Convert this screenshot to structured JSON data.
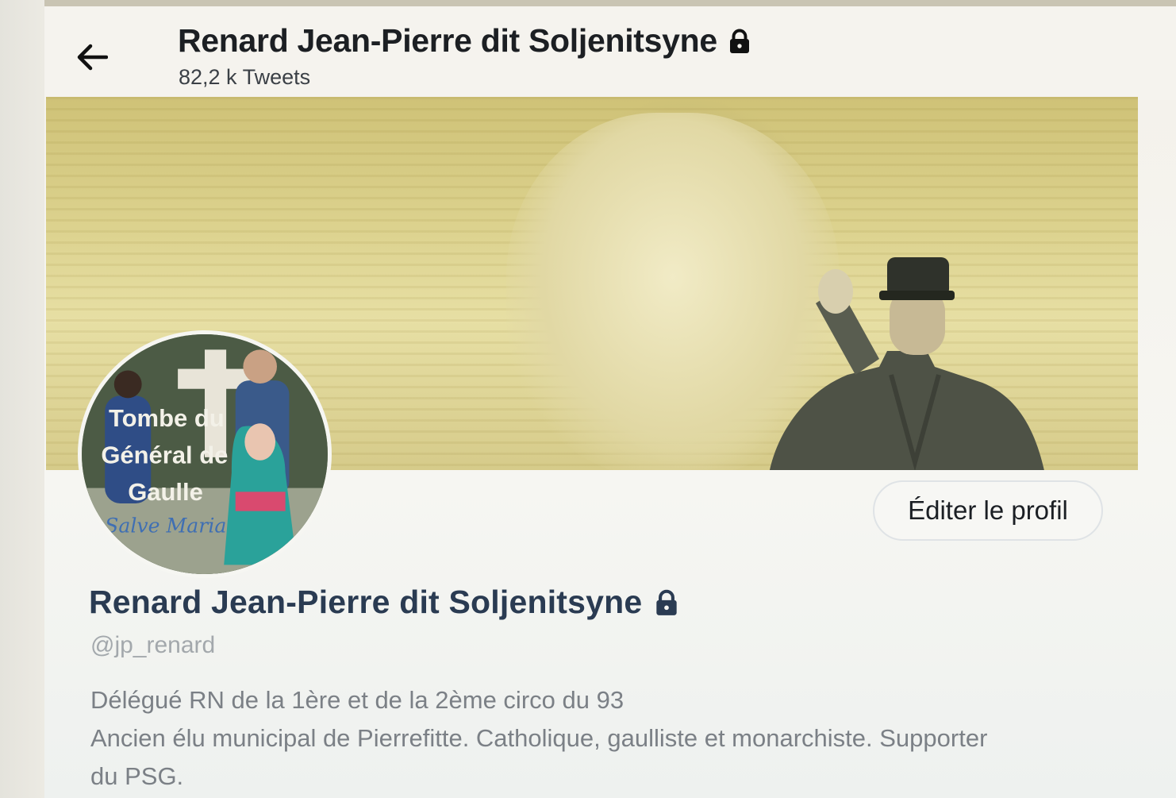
{
  "header": {
    "back_icon": "arrow-left-icon",
    "title": "Renard Jean-Pierre dit Soljenitsyne",
    "lock_icon": "lock-icon",
    "tweet_count": "82,2 k Tweets"
  },
  "banner": {
    "image": "banner-photo"
  },
  "avatar": {
    "overlay_line1": "Tombe du",
    "overlay_line2": "Général de",
    "overlay_line3": "Gaulle",
    "script_text": "Salve Maria"
  },
  "actions": {
    "edit_profile": "Éditer le profil"
  },
  "profile": {
    "name": "Renard Jean-Pierre dit Soljenitsyne",
    "handle": "@jp_renard",
    "bio_line1": "Délégué RN de la 1ère et de la 2ème circo du 93",
    "bio_line2": "Ancien élu municipal de Pierrefitte. Catholique, gaulliste et monarchiste. Supporter",
    "bio_line3": "du PSG."
  },
  "colors": {
    "name": "#2a3b52",
    "handle": "#a3a8ac",
    "bio": "#7b8086",
    "banner": "#dcd28e"
  }
}
